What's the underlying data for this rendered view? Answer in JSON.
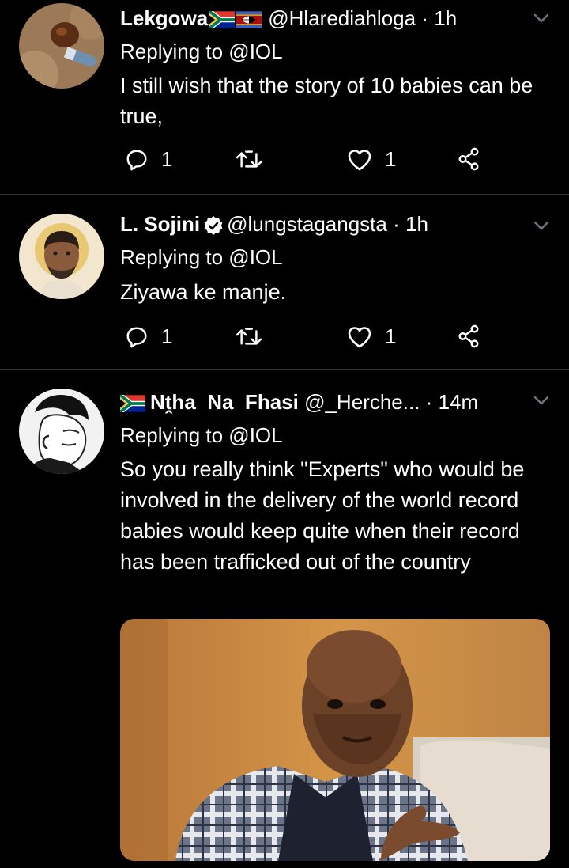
{
  "tweets": [
    {
      "name": "Lekgowa",
      "handle": "@Hlarediahloga",
      "dot": "·",
      "time": "1h",
      "replying": "Replying to @IOL",
      "text": "I still wish that the story of 10 babies can be true,",
      "replies": "1",
      "likes": "1"
    },
    {
      "name": "L. Sojini",
      "handle": "@lungstagangsta",
      "dot": "·",
      "time": "1h",
      "replying": "Replying to @IOL",
      "text": "Ziyawa ke manje.",
      "replies": "1",
      "likes": "1"
    },
    {
      "name": "Nṱha_Na_Fhasi",
      "handle": "@_Herche...",
      "dot": "·",
      "time": "14m",
      "replying": "Replying to @IOL",
      "text": "So you really think \"Experts\" who would be involved in the delivery of the world record babies would keep quite when their record has been trafficked out of the country"
    }
  ],
  "colors": {
    "background": "#000000",
    "text": "#ffffff",
    "icon": "#ffffff",
    "divider": "#2f3336"
  },
  "icons": [
    "reply-icon",
    "retweet-icon",
    "like-icon",
    "share-icon",
    "chevron-down-icon",
    "verified-icon",
    "south-africa-flag-icon",
    "eswatini-flag-icon"
  ]
}
